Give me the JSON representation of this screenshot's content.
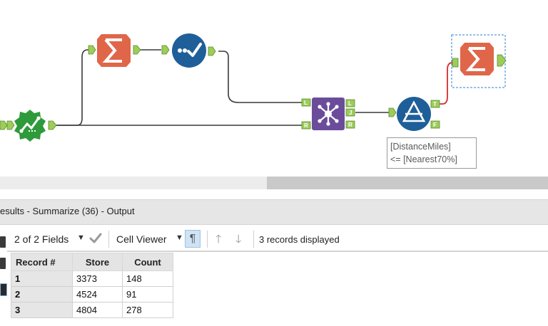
{
  "workflow": {
    "tooltip": {
      "line1": "[DistanceMiles]",
      "line2": "<= [Nearest70%]"
    },
    "anchors": {
      "join_left": "L",
      "join_right": "R",
      "join_out_left": "L",
      "join_out_join": "J",
      "join_out_right": "R",
      "filter_true": "T",
      "filter_false": "F"
    },
    "tools": [
      {
        "icon": "summarize-icon",
        "color": "#e0664a"
      },
      {
        "icon": "select-records-icon",
        "color": "#1f5f99"
      },
      {
        "icon": "spatial-match-icon",
        "color": "#2e9a3a"
      },
      {
        "icon": "join-icon",
        "color": "#6b4c9a"
      },
      {
        "icon": "filter-icon",
        "color": "#1f5f99"
      },
      {
        "icon": "summarize-icon",
        "color": "#e0664a"
      }
    ]
  },
  "results": {
    "title": "esults - Summarize (36) - Output",
    "fields_label": "2 of 2 Fields",
    "viewer_label": "Cell Viewer",
    "records_status": "3 records displayed",
    "columns": [
      "Record #",
      "Store",
      "Count"
    ],
    "rows": [
      [
        "1",
        "3373",
        "148"
      ],
      [
        "2",
        "4524",
        "91"
      ],
      [
        "3",
        "4804",
        "278"
      ]
    ]
  },
  "colors": {
    "anchor": "#9ccc5a",
    "connection": "#3a3a3a",
    "selected_connection": "#d62b2b",
    "selection_box": "#2a7fd4"
  }
}
